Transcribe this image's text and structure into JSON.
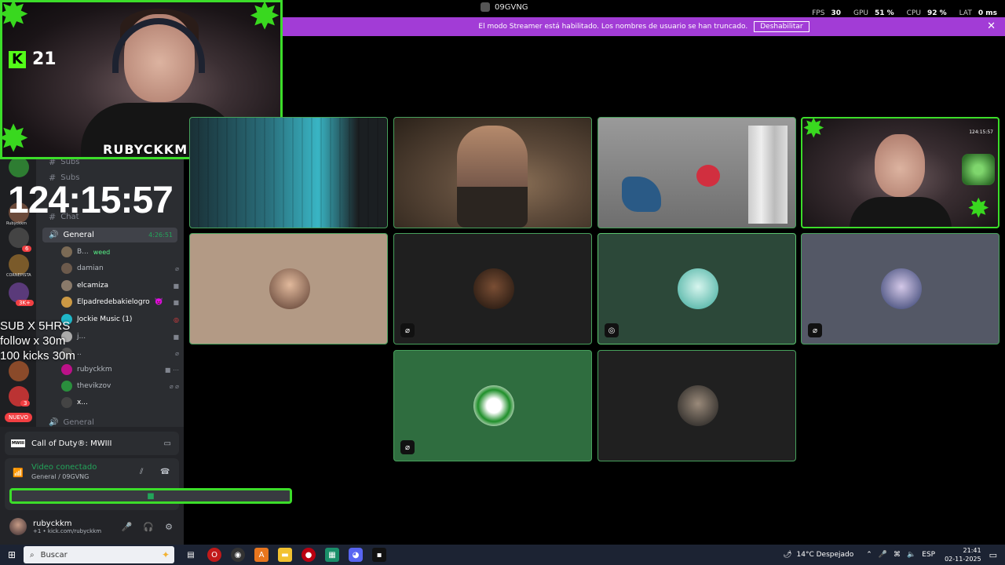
{
  "window": {
    "title": "09GVNG"
  },
  "stats": [
    {
      "label": "FPS",
      "value": "30"
    },
    {
      "label": "GPU",
      "value": "51 %"
    },
    {
      "label": "CPU",
      "value": "92 %"
    },
    {
      "label": "LAT",
      "value": "0 ms"
    }
  ],
  "streamer_banner": {
    "text": "El modo Streamer está habilitado. Los nombres de usuario se han truncado.",
    "button": "Deshabilitar"
  },
  "overlay": {
    "kick_count": "21",
    "webcam_name": "RUBYCKKM",
    "timer": "124:15:57",
    "promo": [
      "SUB X 5HRS",
      "follow x 30m",
      "100 kicks 30m"
    ]
  },
  "rail": {
    "badge1": "6",
    "badge2": "3K+",
    "badge3": "3",
    "nuevo": "NUEVO",
    "caption1": "Rubyckkm",
    "caption2": "CORNEPISTA"
  },
  "channels": {
    "categories": [
      "Subs",
      "Subs",
      "Chat",
      "General"
    ],
    "voice_channel": {
      "name": "General",
      "timer": "4:26:51"
    },
    "members": [
      {
        "name": "B...",
        "tag": "weed",
        "color": "#7b6a55"
      },
      {
        "name": "damian",
        "color": "#6c5a4c"
      },
      {
        "name": "elcamiza",
        "color": "#8a7a6a"
      },
      {
        "name": "Elpadredebakielogro",
        "color": "#c94",
        "extra": "👿"
      },
      {
        "name": "Jockie Music (1)",
        "color": "#1fb7c8"
      },
      {
        "name": "j...",
        "color": "#aaa"
      },
      {
        "name": "..",
        "color": "#555"
      },
      {
        "name": "rubyckkm",
        "color": "#b18"
      },
      {
        "name": "thevikzov",
        "color": "#2a8f3d"
      },
      {
        "name": "x...",
        "color": "#444"
      }
    ]
  },
  "bottom": {
    "game_logo": "MWIII",
    "game": "Call of Duty®: MWIII",
    "voice_status": "Video conectado",
    "voice_channel": "General / 09GVNG",
    "username": "rubyckkm",
    "user_sub": "+1 • kick.com/rubyckkm"
  },
  "grid": {
    "t4_clock": "124:15:57"
  },
  "taskbar": {
    "search_placeholder": "Buscar",
    "weather": "14°C  Despejado",
    "lang": "ESP",
    "time": "21:41",
    "date": "02-11-2025"
  },
  "colors": {
    "accent": "#a23cd6",
    "green": "#23a55a",
    "kick": "#53fc18",
    "tile_border": "#47a15c"
  }
}
